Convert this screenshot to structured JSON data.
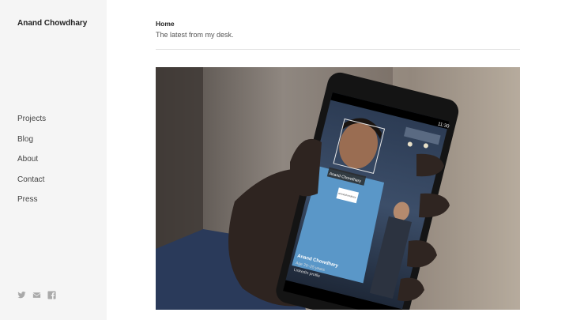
{
  "site": {
    "title": "Anand Chowdhary"
  },
  "nav": {
    "items": [
      {
        "label": "Projects"
      },
      {
        "label": "Blog"
      },
      {
        "label": "About"
      },
      {
        "label": "Contact"
      },
      {
        "label": "Press"
      }
    ]
  },
  "social": [
    "twitter-icon",
    "mail-icon",
    "facebook-icon"
  ],
  "header": {
    "title": "Home",
    "subtitle": "The latest from my desk."
  },
  "hero_image": {
    "phone_status_time": "11:30",
    "face_label": "Anand Chowdhary",
    "badge_text": "anandchowdhary",
    "caption_name": "Anand Chowdhary",
    "caption_age": "Age 20–25 years",
    "caption_link": "LinkedIn profile"
  }
}
